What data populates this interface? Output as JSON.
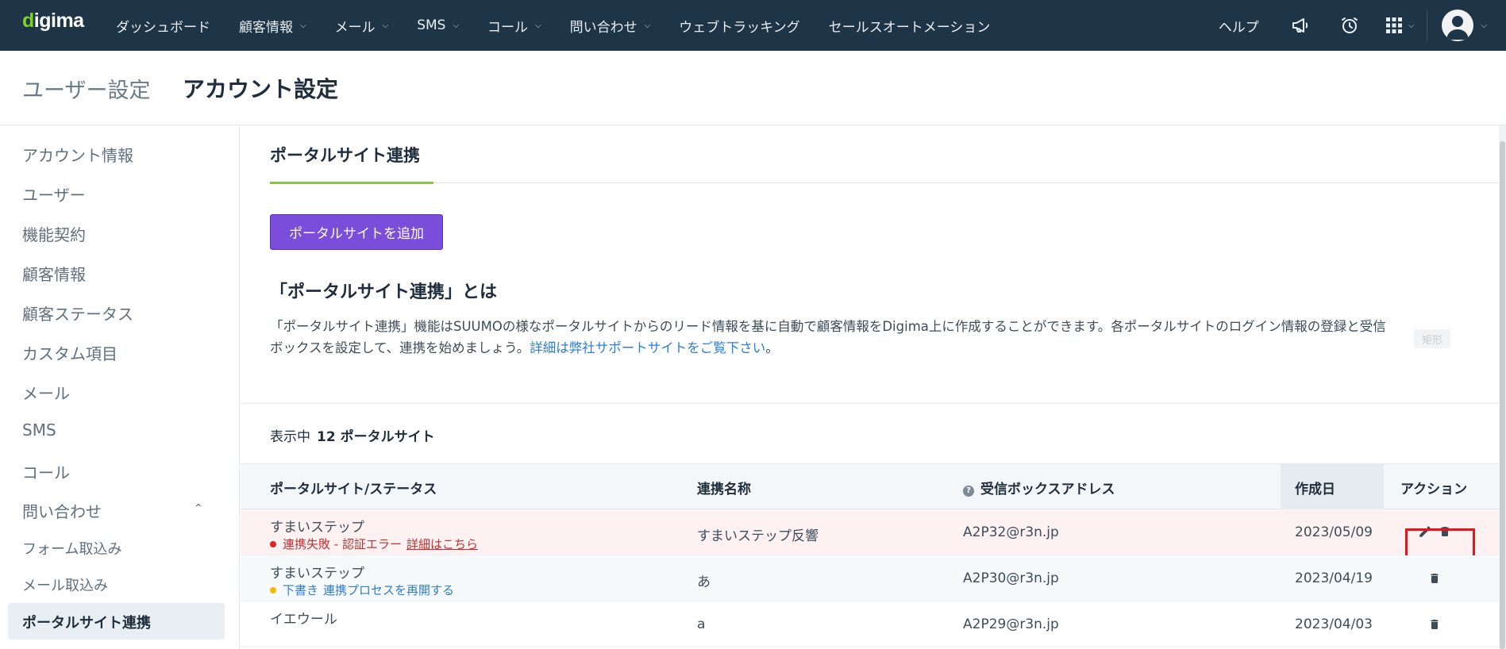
{
  "app": {
    "logo_text": "digima"
  },
  "topnav": {
    "items": [
      {
        "label": "ダッシュボード",
        "has_menu": false
      },
      {
        "label": "顧客情報",
        "has_menu": true
      },
      {
        "label": "メール",
        "has_menu": true
      },
      {
        "label": "SMS",
        "has_menu": true
      },
      {
        "label": "コール",
        "has_menu": true
      },
      {
        "label": "問い合わせ",
        "has_menu": true
      },
      {
        "label": "ウェブトラッキング",
        "has_menu": false
      },
      {
        "label": "セールスオートメーション",
        "has_menu": false
      }
    ],
    "help_label": "ヘルプ",
    "icons": [
      "megaphone-icon",
      "alarm-clock-icon",
      "apps-grid-icon",
      "user-avatar-icon"
    ]
  },
  "page_header": {
    "section": "ユーザー設定",
    "title": "アカウント設定"
  },
  "sidebar": {
    "items": [
      {
        "label": "アカウント情報"
      },
      {
        "label": "ユーザー"
      },
      {
        "label": "機能契約"
      },
      {
        "label": "顧客情報"
      },
      {
        "label": "顧客ステータス"
      },
      {
        "label": "カスタム項目"
      },
      {
        "label": "メール"
      },
      {
        "label": "SMS"
      },
      {
        "label": "コール"
      },
      {
        "label": "問い合わせ"
      }
    ],
    "sub_items": [
      {
        "label": "フォーム取込み"
      },
      {
        "label": "メール取込み"
      },
      {
        "label": "ポータルサイト連携",
        "active": true
      }
    ]
  },
  "main": {
    "tab_title": "ポータルサイト連携",
    "add_button": "ポータルサイトを追加",
    "what_title": "「ポータルサイト連携」とは",
    "description": "「ポータルサイト連携」機能はSUUMOの様なポータルサイトからのリード情報を基に自動で顧客情報をDigima上に作成することができます。各ポータルサイトのログイン情報の登録と受信ボックスを設定して、連携を始めましょう。",
    "description_link": "詳細は弊社サポートサイトをご覧下さい",
    "description_end": "。",
    "rect_badge": "矩形",
    "count_prefix": "表示中",
    "count_value": "12 ポータルサイト"
  },
  "table": {
    "headers": {
      "site_status": "ポータルサイト/ステータス",
      "name": "連携名称",
      "inbox": "受信ボックスアドレス",
      "created": "作成日",
      "actions": "アクション"
    },
    "rows": [
      {
        "site": "すまいステップ",
        "status_type": "error",
        "status_text": "連携失敗 - 認証エラー",
        "status_link": "詳細はこちら",
        "name": "すまいステップ反響",
        "inbox": "A2P32@r3n.jp",
        "created": "2023/05/09",
        "actions": [
          "edit",
          "delete"
        ]
      },
      {
        "site": "すまいステップ",
        "status_type": "draft",
        "status_text": "下書き",
        "status_link": "連携プロセスを再開する",
        "name": "あ",
        "inbox": "A2P30@r3n.jp",
        "created": "2023/04/19",
        "actions": [
          "delete"
        ]
      },
      {
        "site": "イエウール",
        "status_type": "",
        "status_text": "",
        "status_link": "",
        "name": "a",
        "inbox": "A2P29@r3n.jp",
        "created": "2023/04/03",
        "actions": [
          "delete"
        ]
      }
    ]
  },
  "colors": {
    "nav_bg": "#1e3547",
    "accent_green": "#8bc34a",
    "button_purple": "#7b4ddb",
    "error_red": "#c53030",
    "draft_yellow": "#f5b700",
    "link_blue": "#2e7dd1",
    "highlight_red": "#e8141b"
  }
}
